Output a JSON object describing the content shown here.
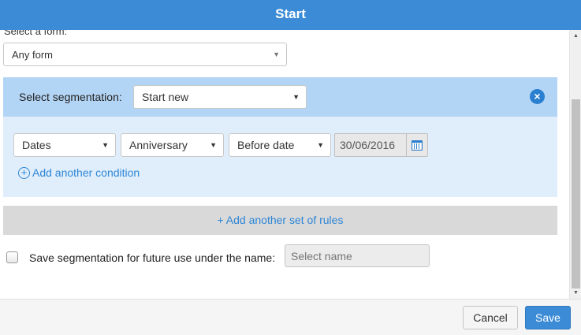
{
  "window": {
    "title": "Start"
  },
  "form": {
    "label": "Select a form:",
    "selected": "Any form"
  },
  "segmentation": {
    "label": "Select segmentation:",
    "selected": "Start new",
    "close_icon": "close-icon"
  },
  "condition": {
    "field": "Dates",
    "type": "Anniversary",
    "operator": "Before date",
    "date_value": "30/06/2016",
    "add_condition_label": "Add another condition"
  },
  "add_set_label": "+ Add another set of rules",
  "save_option": {
    "checked": false,
    "label": "Save segmentation for future use under the name:",
    "placeholder": "Select name"
  },
  "footer": {
    "cancel_label": "Cancel",
    "save_label": "Save"
  },
  "colors": {
    "accent": "#3b8bd6",
    "segment_header": "#b3d5f5",
    "segment_body": "#e0eefb",
    "link": "#2e86d6"
  }
}
